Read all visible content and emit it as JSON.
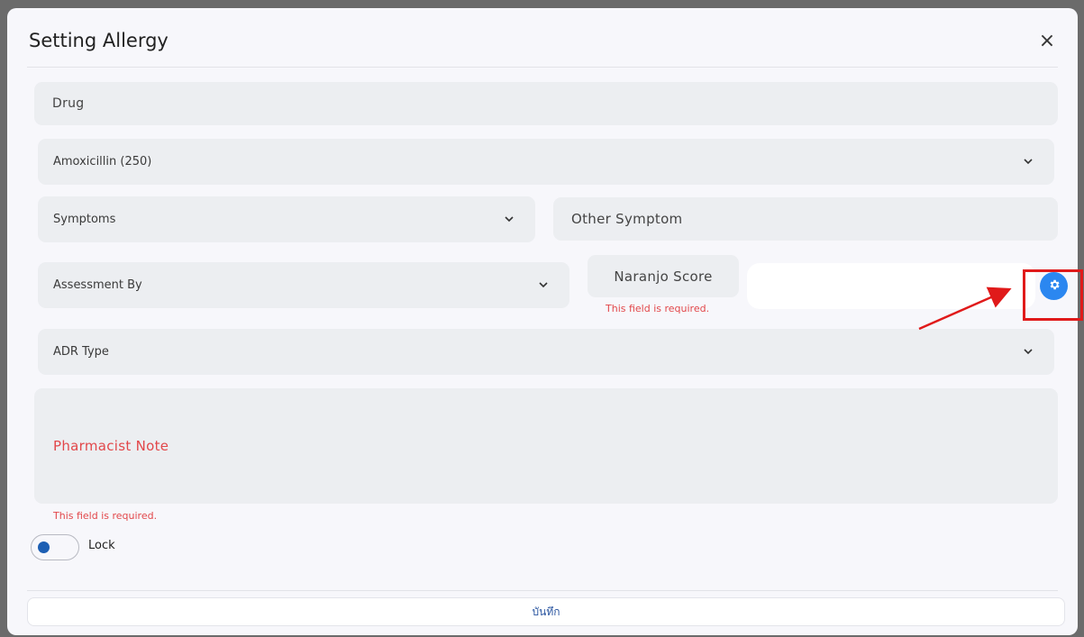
{
  "dialog": {
    "title": "Setting Allergy",
    "close_label": "×"
  },
  "form": {
    "allergy_type": {
      "value": "Drug"
    },
    "drug": {
      "value": "Amoxicillin (250)"
    },
    "symptoms": {
      "value": "Symptoms"
    },
    "other_symptom": {
      "placeholder": "Other Symptom"
    },
    "assessment_by": {
      "value": "Assessment By"
    },
    "naranjo_score": {
      "label": "Naranjo Score",
      "error": "This field is required."
    },
    "adr_type": {
      "value": "ADR Type"
    },
    "pharmacist_note": {
      "placeholder": "Pharmacist Note",
      "error": "This field is required."
    },
    "lock": {
      "label": "Lock",
      "on": true
    }
  },
  "footer": {
    "save_label": "บันทึก"
  },
  "icons": {
    "close": "close-icon",
    "chevron": "chevron-down-icon",
    "gear": "gear-icon"
  },
  "colors": {
    "accent": "#2b87f0",
    "error": "#e2474a",
    "annotation": "#e01a1a",
    "field_bg": "#eceef1"
  }
}
